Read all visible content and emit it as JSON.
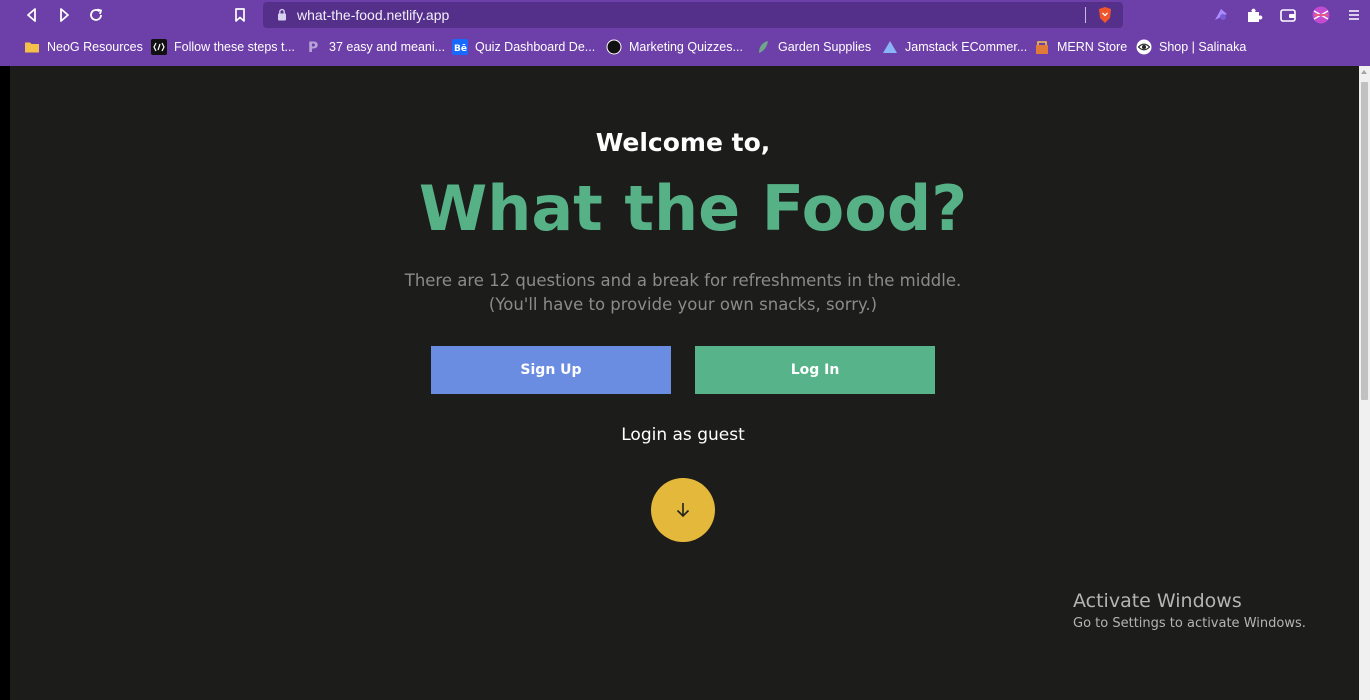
{
  "browser": {
    "url": "what-the-food.netlify.app",
    "bookmarks": [
      {
        "label": "NeoG Resources",
        "icon": "folder-icon"
      },
      {
        "label": "Follow these steps t...",
        "icon": "site-favicon"
      },
      {
        "label": "37 easy and meani...",
        "icon": "site-favicon"
      },
      {
        "label": "Quiz Dashboard De...",
        "icon": "behance-icon"
      },
      {
        "label": "Marketing Quizzes...",
        "icon": "site-favicon"
      },
      {
        "label": "Garden Supplies",
        "icon": "leaf-icon"
      },
      {
        "label": "Jamstack ECommer...",
        "icon": "triangle-icon"
      },
      {
        "label": "MERN Store",
        "icon": "store-icon"
      },
      {
        "label": "Shop | Salinaka",
        "icon": "eye-icon"
      }
    ]
  },
  "hero": {
    "welcome": "Welcome to,",
    "title": "What the Food?",
    "desc_line1": "There are 12 questions and a break for refreshments in the middle.",
    "desc_line2": "(You'll have to provide your own snacks, sorry.)"
  },
  "actions": {
    "signup_label": "Sign Up",
    "login_label": "Log In",
    "guest_label": "Login as guest"
  },
  "watermark": {
    "line1": "Activate Windows",
    "line2": "Go to Settings to activate Windows."
  },
  "colors": {
    "chrome": "#6d3fa8",
    "page_bg": "#1c1c1b",
    "title": "#57b187",
    "signup": "#6a8de2",
    "login": "#57b38a",
    "scroll_button": "#e4b83a"
  }
}
